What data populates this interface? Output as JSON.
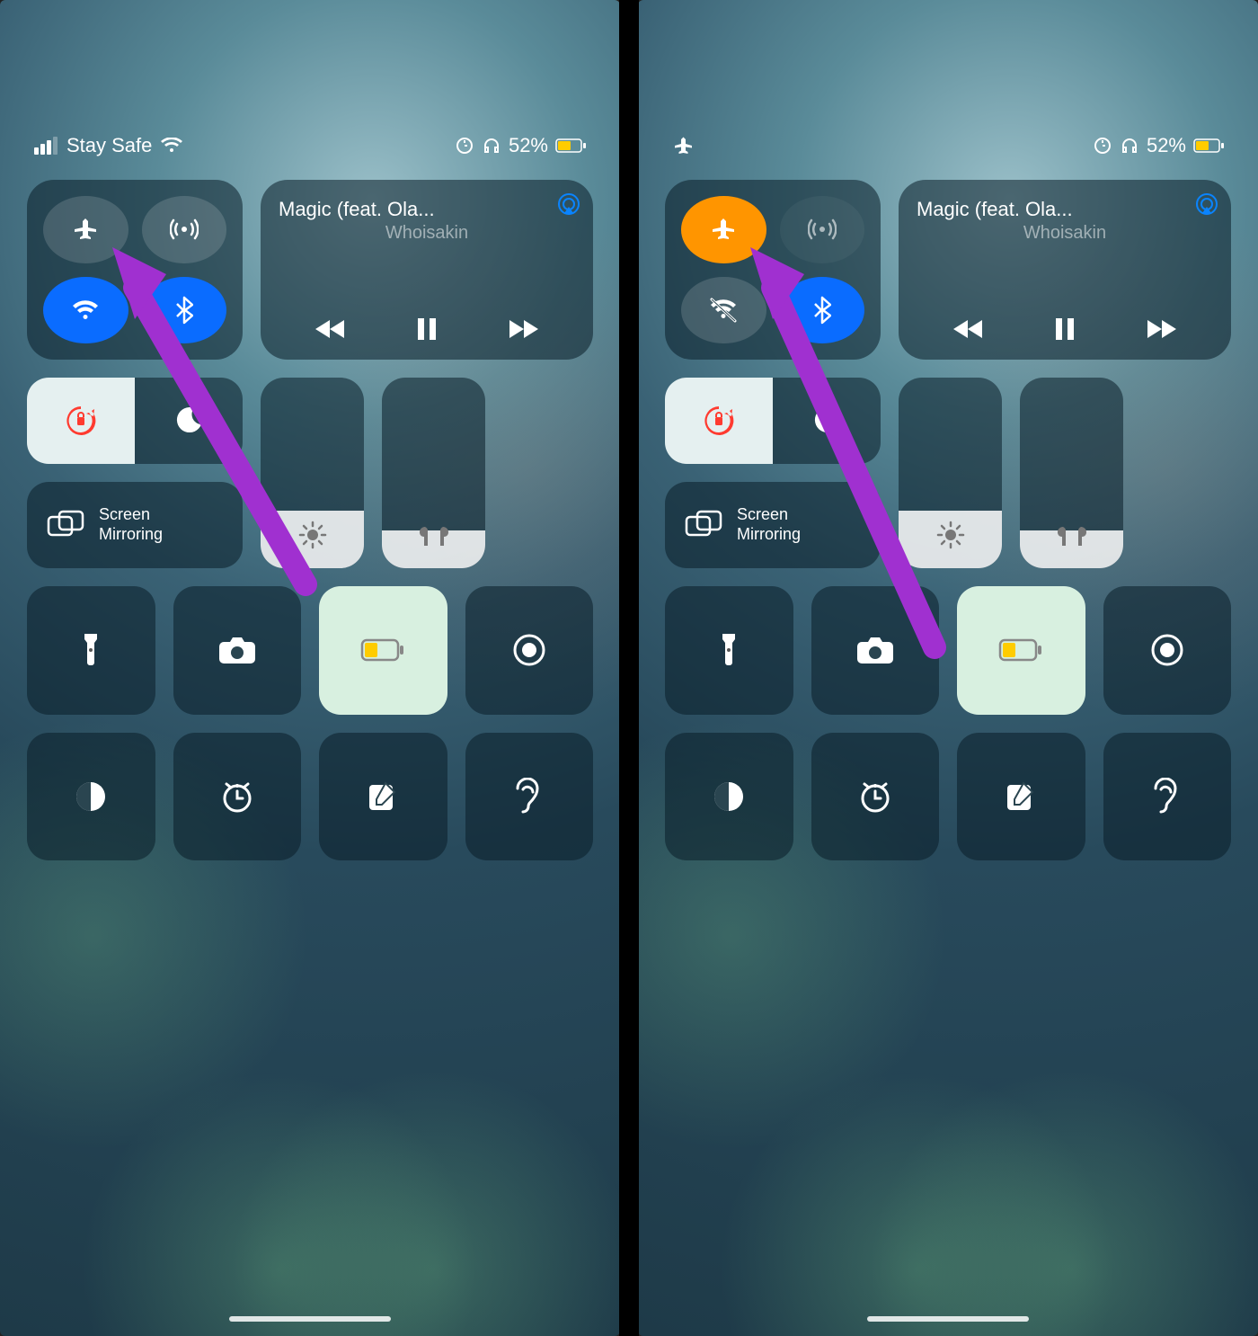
{
  "panes": {
    "left": {
      "status": {
        "carrier": "Stay Safe",
        "battery": "52%",
        "show_airplane": false,
        "show_signal": true
      },
      "connectivity": {
        "airplane": "gray",
        "cellular": "gray",
        "wifi": "blue",
        "wifi_off": false,
        "bluetooth": "blue"
      }
    },
    "right": {
      "status": {
        "carrier": "",
        "battery": "52%",
        "show_airplane": true,
        "show_signal": false
      },
      "connectivity": {
        "airplane": "orange",
        "cellular": "dim",
        "wifi": "gray",
        "wifi_off": true,
        "bluetooth": "blue"
      }
    }
  },
  "media": {
    "title": "Magic (feat. Ola...",
    "artist": "Whoisakin"
  },
  "mirror": {
    "l1": "Screen",
    "l2": "Mirroring"
  },
  "sliders": {
    "brightness_pct": 30,
    "volume_pct": 20
  }
}
